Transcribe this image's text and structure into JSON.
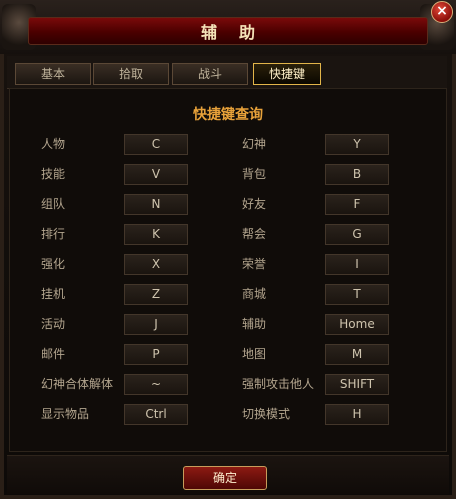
{
  "window": {
    "title": "辅助",
    "close_glyph": "×"
  },
  "tabs": [
    {
      "label": "基本"
    },
    {
      "label": "拾取"
    },
    {
      "label": "战斗"
    },
    {
      "label": "快捷键",
      "active": true
    }
  ],
  "section_title": "快捷键查询",
  "shortcuts": [
    {
      "left_label": "人物",
      "left_key": "C",
      "right_label": "幻神",
      "right_key": "Y"
    },
    {
      "left_label": "技能",
      "left_key": "V",
      "right_label": "背包",
      "right_key": "B"
    },
    {
      "left_label": "组队",
      "left_key": "N",
      "right_label": "好友",
      "right_key": "F"
    },
    {
      "left_label": "排行",
      "left_key": "K",
      "right_label": "帮会",
      "right_key": "G"
    },
    {
      "left_label": "强化",
      "left_key": "X",
      "right_label": "荣誉",
      "right_key": "I"
    },
    {
      "left_label": "挂机",
      "left_key": "Z",
      "right_label": "商城",
      "right_key": "T"
    },
    {
      "left_label": "活动",
      "left_key": "J",
      "right_label": "辅助",
      "right_key": "Home"
    },
    {
      "left_label": "邮件",
      "left_key": "P",
      "right_label": "地图",
      "right_key": "M"
    },
    {
      "left_label": "幻神合体解体",
      "left_key": "~",
      "right_label": "强制攻击他人",
      "right_key": "SHIFT"
    },
    {
      "left_label": "显示物品",
      "left_key": "Ctrl",
      "right_label": "切换模式",
      "right_key": "H"
    }
  ],
  "confirm_label": "确定",
  "colors": {
    "title_bar": "#6a0505",
    "active_tab_border": "#e2b54a",
    "section_title": "#e8a23a"
  }
}
